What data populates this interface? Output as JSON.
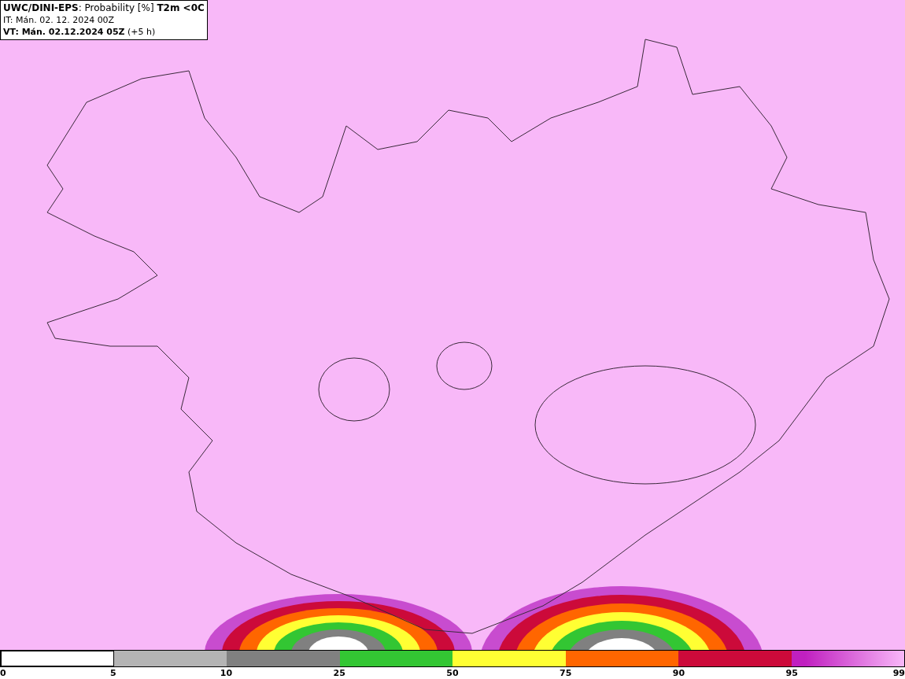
{
  "header": {
    "lines": [
      "**UWC/DINI-EPS**: Probability [%] **T2m <0C**",
      "IT: Mán. 02. 12. 2024 00Z",
      "**VT: Mán. 02.12.2024 05Z** (+5 h)"
    ]
  },
  "legend": {
    "segments": [
      {
        "color": "#ffffff"
      },
      {
        "color": "#b4b4b4"
      },
      {
        "color": "#808080"
      },
      {
        "color": "#33c633"
      },
      {
        "color": "#ffff33"
      },
      {
        "color": "#ff6600"
      },
      {
        "color": "#cc0a3a"
      },
      {
        "color": "#c020c0"
      }
    ],
    "labels": [
      "0",
      "5",
      "10",
      "25",
      "50",
      "75",
      "90",
      "95",
      "99"
    ]
  }
}
